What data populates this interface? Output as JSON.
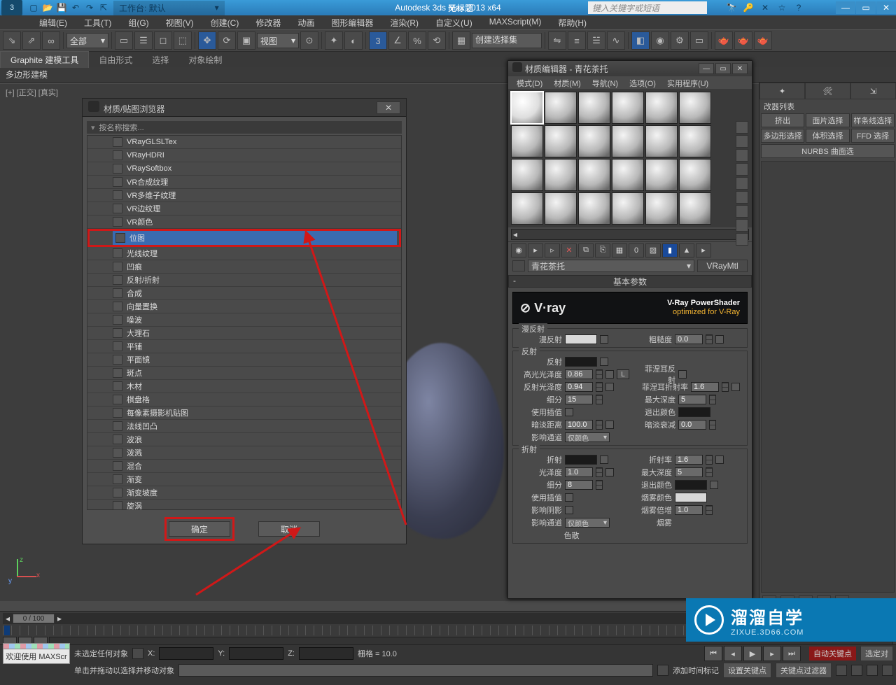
{
  "app": {
    "title": "Autodesk 3ds Max  2013 x64",
    "untitled": "无标题",
    "workspace_label": "工作台: 默认",
    "search_placeholder": "键入关键字或短语"
  },
  "menu": [
    "编辑(E)",
    "工具(T)",
    "组(G)",
    "视图(V)",
    "创建(C)",
    "修改器",
    "动画",
    "图形编辑器",
    "渲染(R)",
    "自定义(U)",
    "MAXScript(M)",
    "帮助(H)"
  ],
  "toolbar": {
    "filter_all": "全部",
    "view_dd": "视图",
    "named_sel": "创建选择集"
  },
  "ribbon": {
    "tabs": [
      "Graphite 建模工具",
      "自由形式",
      "选择",
      "对象绘制"
    ],
    "sub": "多边形建模"
  },
  "viewport": {
    "label": "[+] [正交] [真实]"
  },
  "browser": {
    "title": "材质/贴图浏览器",
    "search": "按名称搜索...",
    "items": [
      "VRayGLSLTex",
      "VRayHDRI",
      "VRaySoftbox",
      "VR合成纹理",
      "VR多维子纹理",
      "VR边纹理",
      "VR颜色",
      "位图",
      "光线纹理",
      "凹痕",
      "反射/折射",
      "合成",
      "向量置换",
      "噪波",
      "大理石",
      "平铺",
      "平面镜",
      "斑点",
      "木材",
      "棋盘格",
      "每像素摄影机贴图",
      "法线凹凸",
      "波浪",
      "泼溅",
      "混合",
      "渐变",
      "渐变坡度",
      "旋涡"
    ],
    "selected_index": 7,
    "ok": "确定",
    "cancel": "取消"
  },
  "material_editor": {
    "title": "材质编辑器 - 青花茶托",
    "menu": [
      "模式(D)",
      "材质(M)",
      "导航(N)",
      "选项(O)",
      "实用程序(U)"
    ],
    "name": "青花茶托",
    "type": "VRayMtl",
    "rollup": "基本参数",
    "vray": {
      "brand": "V·ray",
      "line1": "V-Ray PowerShader",
      "line2": "optimized for V-Ray"
    },
    "diffuse": {
      "group": "漫反射",
      "label": "漫反射",
      "rough_label": "粗糙度",
      "rough": "0.0"
    },
    "reflect": {
      "group": "反射",
      "label": "反射",
      "hglossy_label": "高光光泽度",
      "hglossy": "0.86",
      "l": "L",
      "rglossy_label": "反射光泽度",
      "rglossy": "0.94",
      "subdiv_label": "细分",
      "subdiv": "15",
      "interp_label": "使用插值",
      "dim_label": "暗淡距离",
      "dim": "100.0",
      "affect_label": "影响通道",
      "affect": "仅颜色",
      "fresnel_label": "菲涅耳反射",
      "fior_label": "菲涅耳折射率",
      "fior": "1.6",
      "maxdepth_label": "最大深度",
      "maxdepth": "5",
      "exit_label": "退出颜色",
      "dimfall_label": "暗淡衰减",
      "dimfall": "0.0"
    },
    "refract": {
      "group": "折射",
      "label": "折射",
      "glossy_label": "光泽度",
      "glossy": "1.0",
      "subdiv_label": "细分",
      "subdiv": "8",
      "interp_label": "使用插值",
      "shadows_label": "影响阴影",
      "affect_label": "影响通道",
      "affect": "仅颜色",
      "ior_label": "折射率",
      "ior": "1.6",
      "maxdepth_label": "最大深度",
      "maxdepth": "5",
      "exit_label": "退出颜色",
      "fog_label": "烟雾颜色",
      "fogmult_label": "烟雾倍增",
      "fogmult": "1.0",
      "fogbias_label": "烟雾",
      "disp_label": "色散"
    }
  },
  "cmd": {
    "mod_list": "改器列表",
    "buttons": [
      "挤出",
      "面片选择",
      "样条线选择",
      "多边形选择",
      "体积选择",
      "FFD 选择",
      "NURBS 曲面选"
    ]
  },
  "timeline": {
    "pos": "0 / 100"
  },
  "status": {
    "no_sel": "未选定任何对象",
    "hint": "单击并拖动以选择并移动对象",
    "x": "X:",
    "y": "Y:",
    "z": "Z:",
    "grid": "栅格 = 10.0",
    "welcome": "欢迎使用 MAXScr",
    "add_time": "添加时间标记",
    "autokey": "自动关键点",
    "setkey": "设置关键点",
    "selected": "选定对",
    "keyfilter": "关键点过滤器"
  },
  "watermark": {
    "t1": "溜溜自学",
    "t2": "ZIXUE.3D66.COM"
  }
}
